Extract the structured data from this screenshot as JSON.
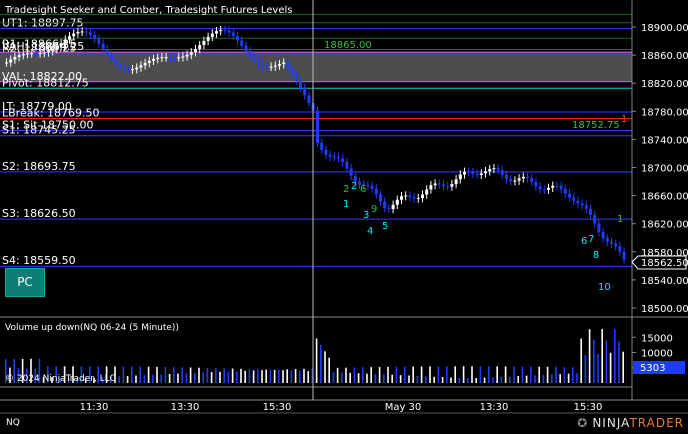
{
  "chart_title": "Tradesight Seeker and Comber, Tradesight Futures Levels",
  "price_axis_ticks": [
    "18900.00",
    "18860.00",
    "18820.00",
    "18780.00",
    "18740.00",
    "18700.00",
    "18660.00",
    "18620.00",
    "18580.00",
    "18540.00",
    "18500.00"
  ],
  "last_price": "18562.50",
  "levels": [
    {
      "label": "R1: 18866.25",
      "price": 18868,
      "color": "#3a3aff",
      "overlap": true
    },
    {
      "label": "UT1: 18897.75",
      "price": 18897.75,
      "color": "#3a3aff",
      "overlap": true
    },
    {
      "label": "VAH: 18864.25",
      "price": 18864.25,
      "color": "#ff44ff",
      "overlap": true
    },
    {
      "label": "R2: 18860.25",
      "price": 18862,
      "color": "#3a3aff",
      "overlap": true
    },
    {
      "label": "VAL: 18822.00",
      "price": 18822,
      "color": "#ff44ff",
      "overlap": false
    },
    {
      "label": "Pivot: 18812.75",
      "price": 18812.75,
      "color": "#00d0d0",
      "overlap": false
    },
    {
      "label": "LT: 18779.00",
      "price": 18779,
      "color": "#3a3aff",
      "overlap": false
    },
    {
      "label": "LBreak: 18769.50",
      "price": 18769.5,
      "color": "#ff2222",
      "overlap": false
    },
    {
      "label": "S1: Sit 18750.00",
      "price": 18752.75,
      "color": "#3a3aff",
      "overlap": false
    },
    {
      "label": "S1: 18745.25",
      "price": 18745.25,
      "color": "#3a3aff",
      "overlap": false
    },
    {
      "label": "S2: 18693.75",
      "price": 18693.75,
      "color": "#3a3aff",
      "overlap": false
    },
    {
      "label": "S3: 18626.50",
      "price": 18626.5,
      "color": "#3a3aff",
      "overlap": false
    },
    {
      "label": "S4: 18559.50",
      "price": 18559.5,
      "color": "#3a3aff",
      "overlap": false
    }
  ],
  "chart_annotations": {
    "level_18865": "18865.00",
    "level_18752": "18752.75",
    "marker_1": "1"
  },
  "pc_button": "PC",
  "volume_title": "Volume up down(NQ 06-24 (5 Minute))",
  "volume_axis_ticks": [
    "15000",
    "10000",
    "5000"
  ],
  "volume_last": "5303",
  "copyright": "© 2024 NinjaTrader, LLC",
  "time_labels": [
    "11:30",
    "13:30",
    "15:30",
    "May 30",
    "13:30",
    "15:30"
  ],
  "instrument_tab": "NQ",
  "logo": {
    "ninja": "NINJA",
    "trader": "TRADER"
  },
  "seq_labels": [
    {
      "t": "1",
      "c": "#00e6ff"
    },
    {
      "t": "2",
      "c": "#00e6ff"
    },
    {
      "t": "3",
      "c": "#00e6ff"
    },
    {
      "t": "4",
      "c": "#00e6ff"
    },
    {
      "t": "5",
      "c": "#00e6ff"
    },
    {
      "t": "6",
      "c": "#00e6ff"
    },
    {
      "t": "7",
      "c": "#00e6ff"
    },
    {
      "t": "8",
      "c": "#00e6ff"
    },
    {
      "t": "10",
      "c": "#00e6ff"
    },
    {
      "t": "2",
      "c": "#2fbf2f"
    },
    {
      "t": "6",
      "c": "#2fbf2f"
    },
    {
      "t": "9",
      "c": "#2fbf2f"
    },
    {
      "t": "1",
      "c": "#2fbf2f"
    }
  ],
  "colors": {
    "up": "#ffffff",
    "down": "#1e3cff",
    "grid": "#2a2a55",
    "axis": "#888888"
  }
}
